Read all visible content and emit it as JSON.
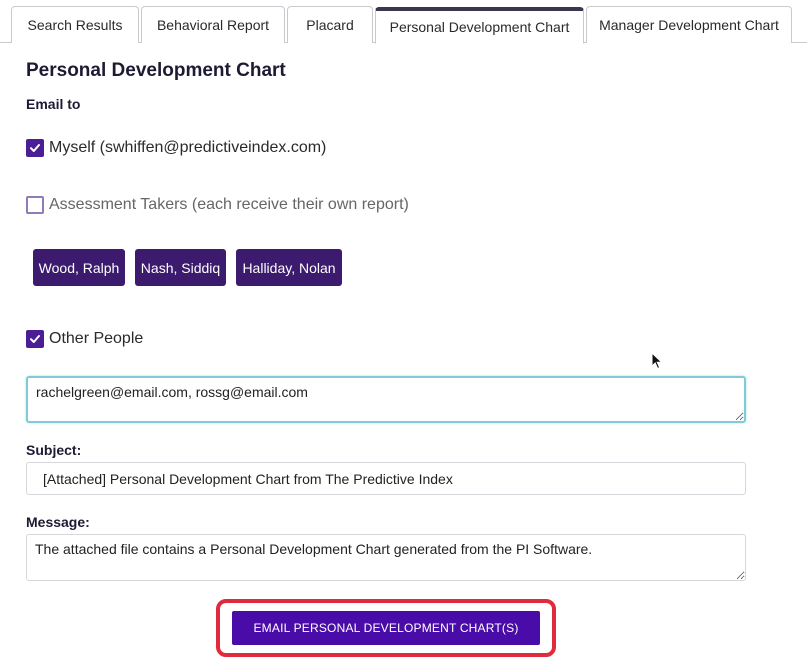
{
  "tabs": [
    {
      "label": "Search Results"
    },
    {
      "label": "Behavioral Report"
    },
    {
      "label": "Placard"
    },
    {
      "label": "Personal Development Chart",
      "active": true
    },
    {
      "label": "Manager Development Chart"
    }
  ],
  "page": {
    "title": "Personal Development Chart"
  },
  "email_to": {
    "label": "Email to",
    "myself": {
      "label": "Myself (swhiffen@predictiveindex.com)",
      "checked": true
    },
    "assessment_takers": {
      "label": "Assessment Takers (each receive their own report)",
      "checked": false
    },
    "takers": [
      "Wood, Ralph",
      "Nash, Siddiq",
      "Halliday, Nolan"
    ],
    "other_people": {
      "label": "Other People",
      "checked": true,
      "value": "rachelgreen@email.com, rossg@email.com"
    }
  },
  "subject": {
    "label": "Subject:",
    "value": "[Attached] Personal Development Chart from The Predictive Index"
  },
  "message": {
    "label": "Message:",
    "value": "The attached file contains a Personal Development Chart generated from the PI Software."
  },
  "actions": {
    "send_label": "EMAIL PERSONAL DEVELOPMENT CHART(S)"
  },
  "colors": {
    "accent": "#4a0ca8",
    "chip": "#3c1a6e",
    "highlight": "#e02b3c",
    "focus": "#7fcbd8"
  },
  "icons": {
    "check": "checkmark-icon",
    "cursor": "mouse-pointer-icon",
    "resize": "resize-grip-icon"
  }
}
